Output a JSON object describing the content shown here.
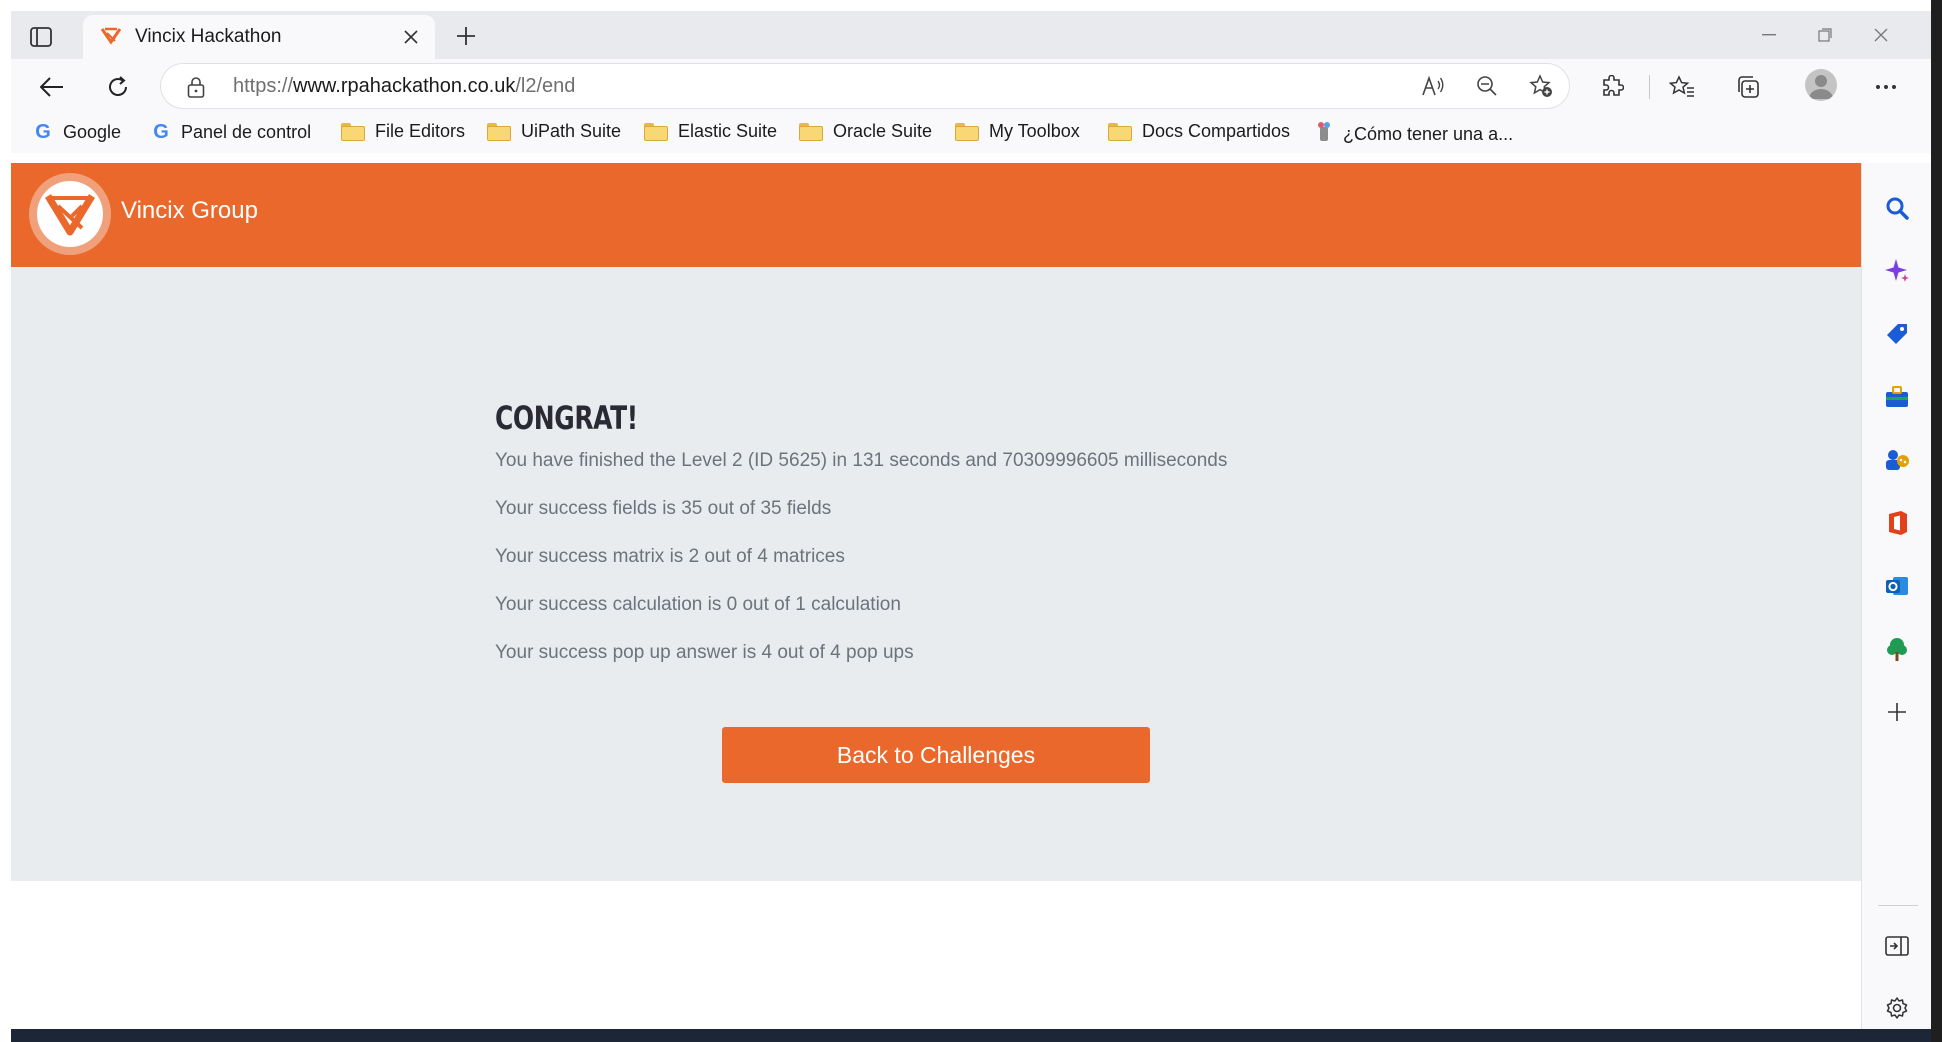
{
  "browser": {
    "tab": {
      "title": "Vincix Hackathon"
    },
    "address": {
      "url_prefix": "https://",
      "url_host": "www.rpahackathon.co.uk",
      "url_path": "/l2/end"
    },
    "bookmarks": [
      {
        "label": "Google",
        "icon": "google-icon"
      },
      {
        "label": "Panel de control",
        "icon": "google-icon"
      },
      {
        "label": "File Editors",
        "icon": "folder-icon"
      },
      {
        "label": "UiPath Suite",
        "icon": "folder-icon"
      },
      {
        "label": "Elastic Suite",
        "icon": "folder-icon"
      },
      {
        "label": "Oracle Suite",
        "icon": "folder-icon"
      },
      {
        "label": "My Toolbox",
        "icon": "folder-icon"
      },
      {
        "label": "Docs Compartidos",
        "icon": "folder-icon"
      },
      {
        "label": "¿Cómo tener una a...",
        "icon": "site-icon"
      }
    ]
  },
  "page": {
    "brand": "Vincix Group",
    "heading": "CONGRAT!",
    "lines": [
      "You have finished the Level 2 (ID 5625) in 131 seconds and 70309996605 milliseconds",
      "Your success fields is 35 out of 35 fields",
      "Your success matrix is 2 out of 4 matrices",
      "Your success calculation is 0 out of 1 calculation",
      "Your success pop up answer is 4 out of 4 pop ups"
    ],
    "button_label": "Back to Challenges"
  },
  "colors": {
    "brand_orange": "#ea682b",
    "content_bg": "#e9ecef",
    "text_muted": "#6c737a",
    "heading": "#2a2a35"
  }
}
